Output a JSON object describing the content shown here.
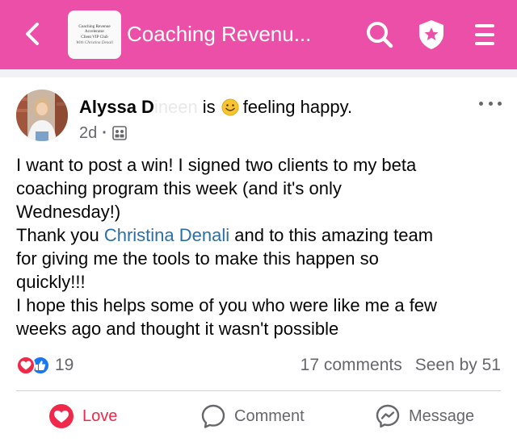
{
  "topbar": {
    "back_icon": "chevron-left-icon",
    "group_thumbnail_lines": [
      "Coaching Revenue",
      "Accelerator",
      "Client VIP Club",
      "With Christina Denali"
    ],
    "group_title": "Coaching Revenu...",
    "search_icon": "search-icon",
    "admin_icon": "shield-star-icon",
    "menu_icon": "hamburger-menu-icon",
    "bar_color": "#ec4fa7"
  },
  "post": {
    "author_first": "Alyssa D",
    "author_last_faded": "ineen",
    "activity_is": "is",
    "activity_emoji": "smiling-face-icon",
    "activity_feeling": "feeling happy.",
    "timestamp": "2d",
    "meta_separator": "·",
    "audience_icon": "group-audience-icon",
    "more_icon": "more-horizontal-icon",
    "body": {
      "line1": "I want to post a win! I signed two clients to my beta",
      "line2": "coaching program this week (and it's only",
      "line3": "Wednesday!)",
      "line4_before": "Thank you ",
      "line4_mention": "Christina Denali",
      "line4_after": " and to this amazing team",
      "line5": "for giving me the tools to make this happen so",
      "line6": "quickly!!!",
      "line7": "I hope this helps some of you who were like me a few",
      "line8": "weeks ago and thought it wasn't possible"
    }
  },
  "stats": {
    "reaction_icons": [
      "love-reaction-icon",
      "like-reaction-icon"
    ],
    "reaction_count": "19",
    "comments": "17 comments",
    "seen_by": "Seen by 51"
  },
  "actions": {
    "love_label": "Love",
    "comment_label": "Comment",
    "message_label": "Message",
    "love_color": "#f0284a",
    "mention_color": "#2d6ea6"
  }
}
